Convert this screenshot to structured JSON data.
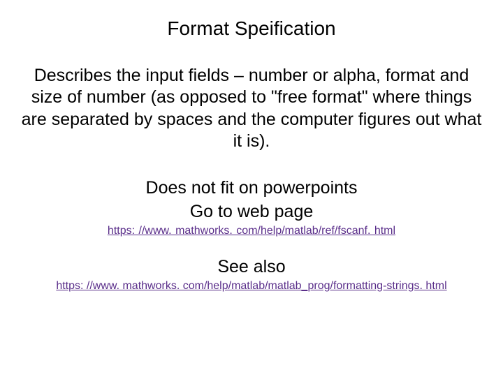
{
  "title": "Format Speification",
  "paragraph": "Describes the input fields – number or alpha, format and size of number (as opposed to \"free format\" where things are separated by spaces and the computer figures out what it is).",
  "sub_line1": "Does not fit on powerpoints",
  "sub_line2": "Go to web page",
  "link1": "https: //www. mathworks. com/help/matlab/ref/fscanf. html",
  "see_also": "See also",
  "link2": "https: //www. mathworks. com/help/matlab/matlab_prog/formatting-strings. html"
}
